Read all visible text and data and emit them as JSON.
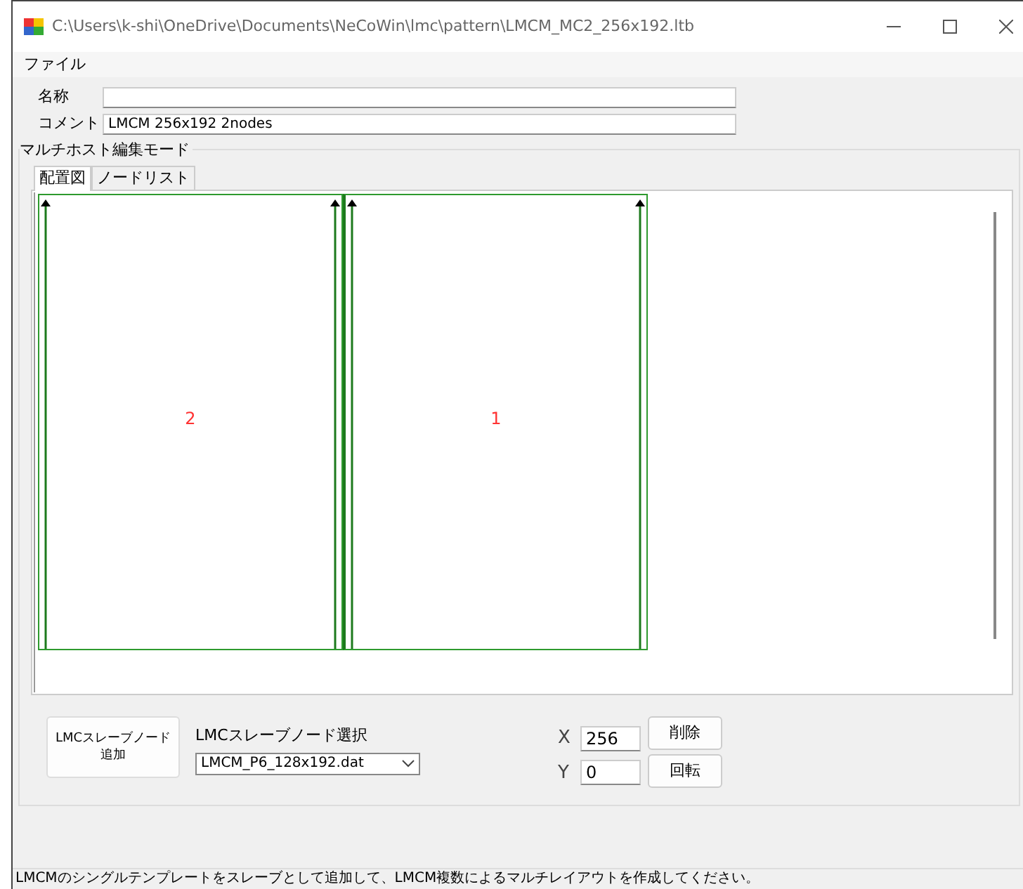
{
  "window": {
    "title": "C:\\Users\\k-shi\\OneDrive\\Documents\\NeCoWin\\lmc\\pattern\\LMCM_MC2_256x192.ltb"
  },
  "menu": [
    {
      "label": "ファイル"
    }
  ],
  "fields": [
    {
      "label": "名称"
    },
    {
      "label": "コメント",
      "value": "LMCM 256x192 2nodes"
    }
  ],
  "group": {
    "title": "マルチホスト編集モード",
    "tabs": [
      {
        "label": "配置図",
        "selected": true
      },
      {
        "label": "ノードリスト",
        "selected": false
      }
    ],
    "nodes": [
      {
        "label": "2"
      },
      {
        "label": "1"
      }
    ],
    "add_button": "LMCスレーブノード追加",
    "select_label": "LMCスレーブノード選択",
    "select_value": "LMCM_P6_128x192.dat",
    "coords": [
      {
        "label": "X",
        "value": "256"
      },
      {
        "label": "Y",
        "value": "0"
      }
    ],
    "buttons": [
      "削除",
      "回転"
    ]
  },
  "status_bar": "LMCMのシングルテンプレートをスレーブとして追加して、LMCM複数によるマルチレイアウトを作成してください。"
}
